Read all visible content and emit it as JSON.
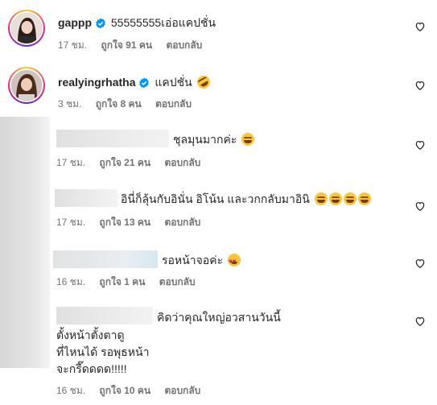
{
  "comments": [
    {
      "username": "gappp",
      "text": "55555555เอ่อแคปชั่น",
      "time": "17 ชม.",
      "likes": "ถูกใจ 91 คน",
      "reply": "ตอบกลับ",
      "verified": true
    },
    {
      "username": "realyingrhatha",
      "text": "แคปชั่น",
      "emoji": "rolling-laughing-emoji",
      "time": "3 ชม.",
      "likes": "ถูกใจ 8 คน",
      "reply": "ตอบกลับ",
      "verified": true
    },
    {
      "text": "ชุลมุนมากค่ะ",
      "emoji": "grinning-squinting-emoji",
      "time": "17 ชม.",
      "likes": "ถูกใจ 21 คน",
      "reply": "ตอบกลับ"
    },
    {
      "text": "อินี่ก็ลุ้นกับอินั่น อิโน้น และวกกลับมาอินิ",
      "emoji": "grinning-squinting-emoji x4",
      "time": "17 ชม.",
      "likes": "ถูกใจ 13 คน",
      "reply": "ตอบกลับ"
    },
    {
      "text": "รอหน้าจอค่ะ",
      "emoji": "heart-eyes-emoji",
      "time": "16 ชม.",
      "likes": "ถูกใจ 1 คน",
      "reply": "ตอบกลับ"
    },
    {
      "lines": [
        "คิดว่าคุณใหญ่อวสานวันนี้",
        "ตั้งหน้าตั้งตาดู",
        "ที่ไหนได้ รอพุธหน้า",
        "จะกรี๊ดดดด!!!!!"
      ],
      "time": "16 ชม.",
      "likes": "ถูกใจ 10 คน",
      "reply": "ตอบกลับ"
    }
  ],
  "icons": {
    "like": "heart-outline-icon",
    "verified": "verified-badge-icon",
    "verified_color": "#0095f6"
  }
}
